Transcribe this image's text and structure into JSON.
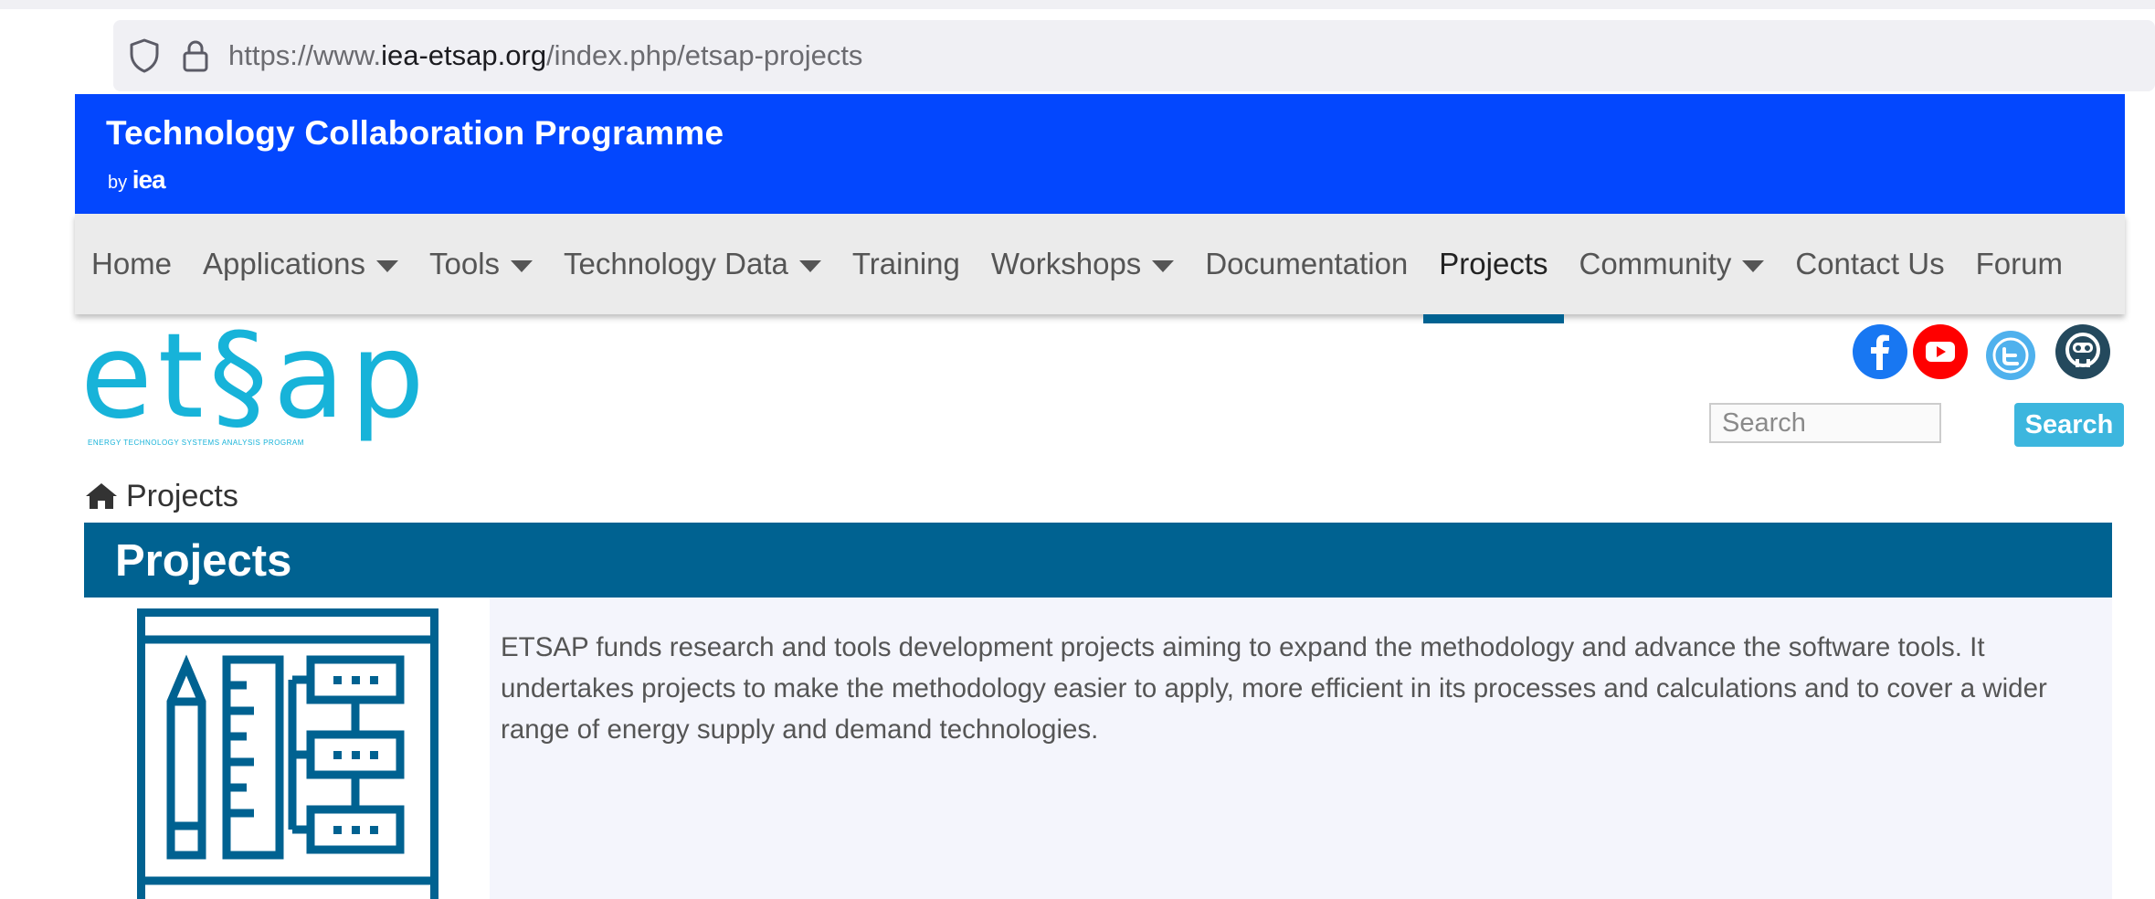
{
  "browser": {
    "url_prefix": "https://www.",
    "url_domain": "iea-etsap.org",
    "url_path": "/index.php/etsap-projects"
  },
  "banner": {
    "title": "Technology Collaboration Programme",
    "by": "by",
    "brand": "iea"
  },
  "nav": {
    "items": [
      {
        "label": "Home",
        "dropdown": false
      },
      {
        "label": "Applications",
        "dropdown": true
      },
      {
        "label": "Tools",
        "dropdown": true
      },
      {
        "label": "Technology Data",
        "dropdown": true
      },
      {
        "label": "Training",
        "dropdown": false
      },
      {
        "label": "Workshops",
        "dropdown": true
      },
      {
        "label": "Documentation",
        "dropdown": false
      },
      {
        "label": "Projects",
        "dropdown": false,
        "active": true
      },
      {
        "label": "Community",
        "dropdown": true
      },
      {
        "label": "Contact Us",
        "dropdown": false
      },
      {
        "label": "Forum",
        "dropdown": false
      }
    ]
  },
  "logo": {
    "text": "et§ap",
    "subtitle": "ENERGY TECHNOLOGY SYSTEMS ANALYSIS PROGRAM"
  },
  "social": [
    {
      "name": "facebook-icon",
      "color": "#1877f2"
    },
    {
      "name": "youtube-icon",
      "color": "#ff0000"
    },
    {
      "name": "twitter-icon",
      "color": "#4fb1ed"
    },
    {
      "name": "forum-icon",
      "color": "#24495d"
    }
  ],
  "search": {
    "placeholder": "Search",
    "button_label": "Search"
  },
  "breadcrumb": {
    "current": "Projects"
  },
  "page": {
    "title": "Projects",
    "description": "ETSAP funds research and tools development projects aiming to expand the methodology and advance the software tools. It undertakes projects to make the methodology easier to apply, more efficient in its processes and calculations and to cover a wider range of energy supply and demand technologies."
  },
  "colors": {
    "banner": "#0347fe",
    "primary": "#006291",
    "logo": "#17b3d9",
    "search_button": "#3cb6de"
  }
}
